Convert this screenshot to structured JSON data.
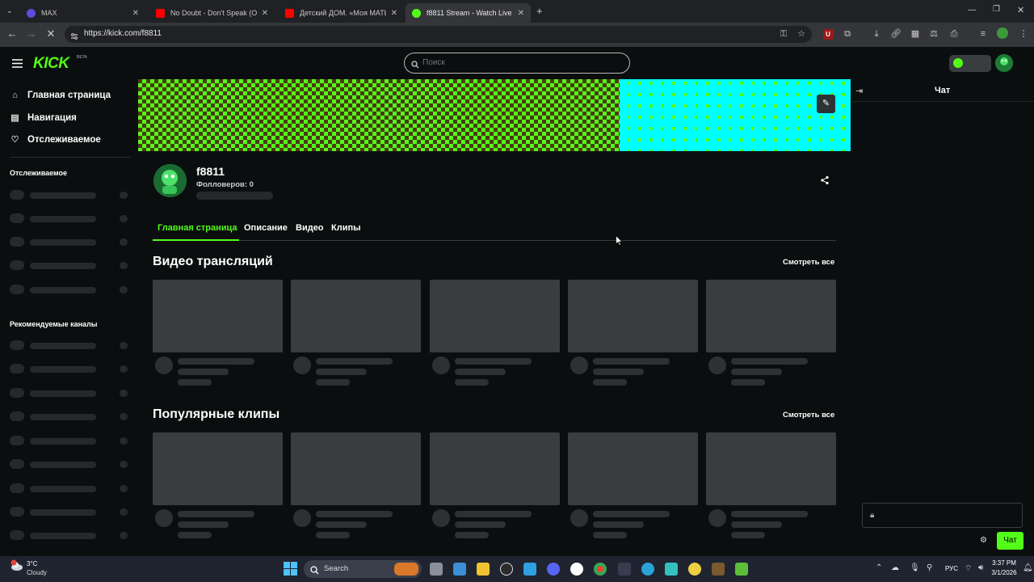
{
  "browser": {
    "tabs": [
      {
        "label": "MAX",
        "icon": "max-app-icon",
        "color": "#5b4cdb"
      },
      {
        "label": "No Doubt - Don't Speak (Offici",
        "icon": "youtube-icon",
        "color": "#ff0000"
      },
      {
        "label": "Детский ДОМ. «Моя МАТЬ - А",
        "icon": "youtube-icon",
        "color": "#ff0000"
      },
      {
        "label": "f8811 Stream - Watch Live on K",
        "icon": "kick-icon",
        "color": "#53fc18"
      }
    ],
    "url": "https://kick.com/f8811"
  },
  "header": {
    "logo": "KICK",
    "logo_badge": "BETA",
    "search_placeholder": "Поиск"
  },
  "sidebar": {
    "nav": [
      {
        "label": "Главная страница",
        "icon": "home-icon"
      },
      {
        "label": "Навигация",
        "icon": "browse-icon"
      },
      {
        "label": "Отслеживаемое",
        "icon": "heart-icon"
      }
    ],
    "following_heading": "Отслеживаемое",
    "recommended_heading": "Рекомендуемые каналы"
  },
  "channel": {
    "name": "f8811",
    "followers": "Фолловеров: 0",
    "tabs": [
      "Главная страница",
      "Описание",
      "Видео",
      "Клипы"
    ],
    "active_tab": "Главная страница"
  },
  "sections": {
    "vods_title": "Видео трансляций",
    "clips_title": "Популярные клипы",
    "see_all": "Смотреть все"
  },
  "chat": {
    "title": "Чат",
    "send_label": "Чат"
  },
  "taskbar": {
    "weather_temp": "3°C",
    "weather_desc": "Cloudy",
    "search_label": "Search",
    "lang": "РУС",
    "time": "3:37 PM",
    "date": "3/1/2026"
  },
  "colors": {
    "accent": "#53fc18",
    "banner_cyan": "#00ffff",
    "background": "#0b0e0f"
  }
}
